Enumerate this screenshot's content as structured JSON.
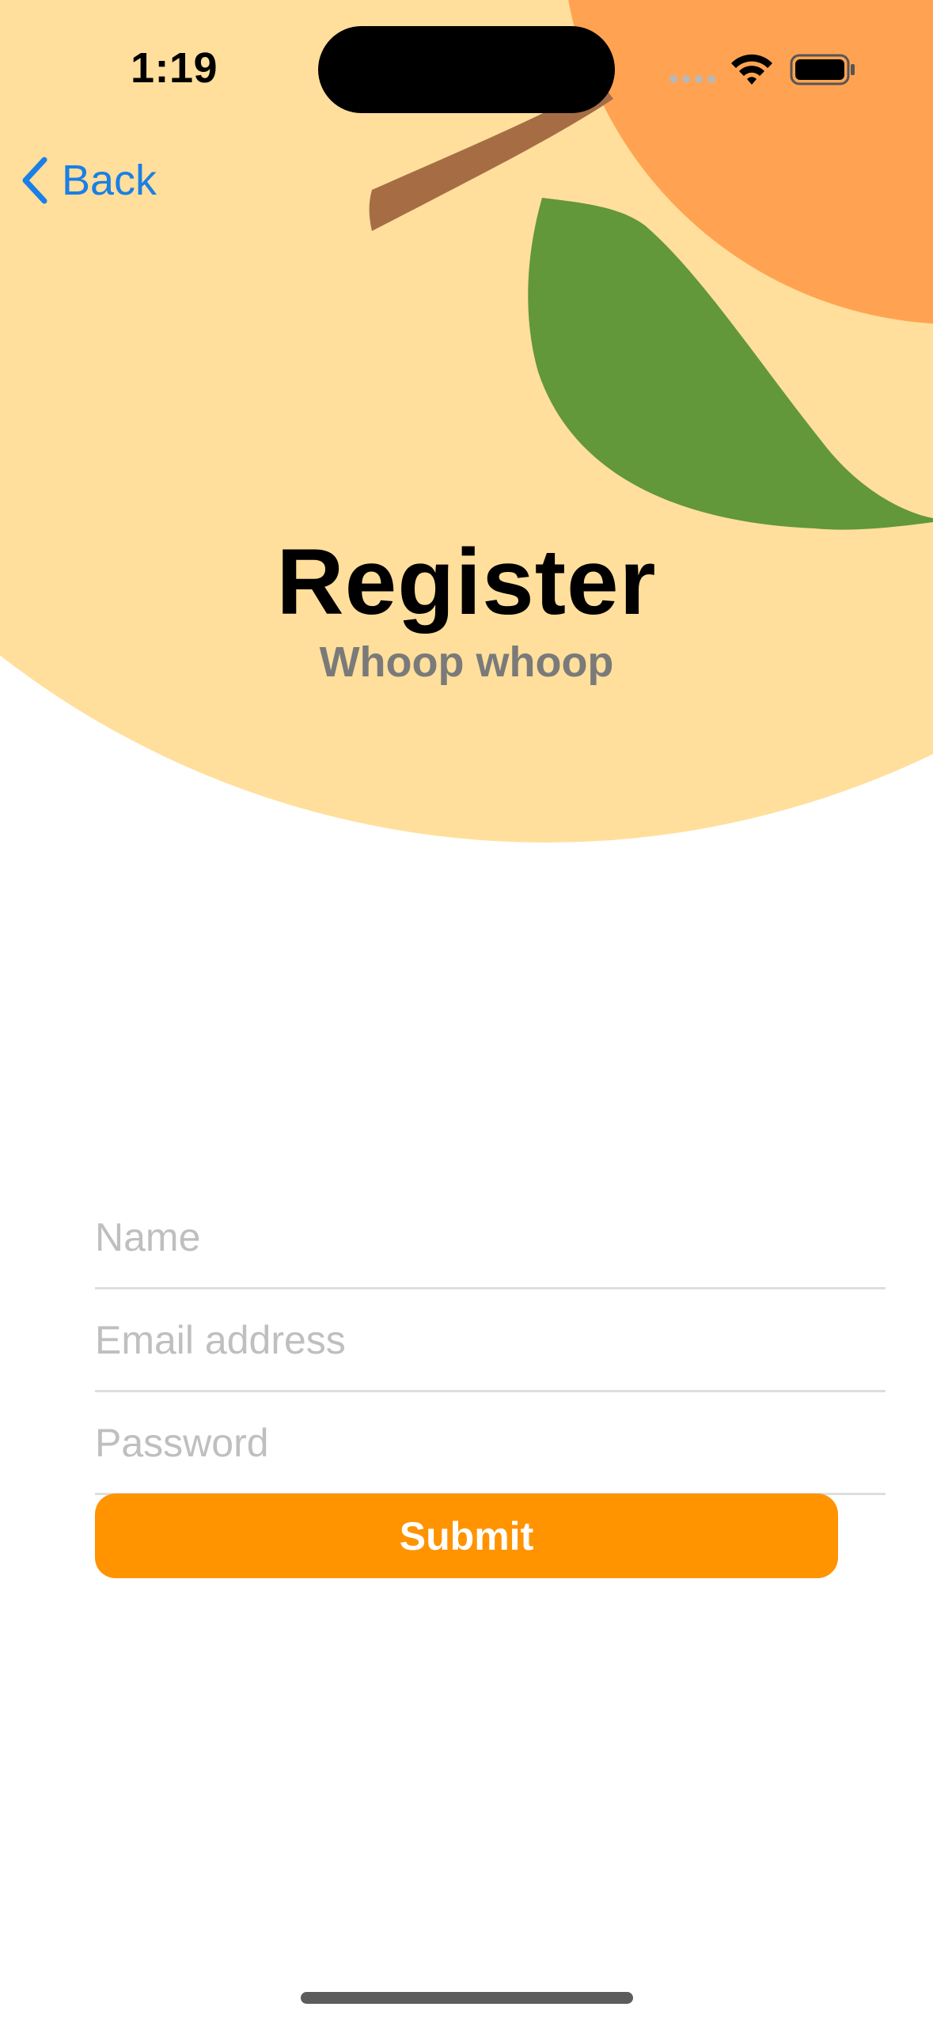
{
  "status_bar": {
    "time": "1:19"
  },
  "navigation": {
    "back_label": "Back"
  },
  "header": {
    "title": "Register",
    "subtitle": "Whoop whoop"
  },
  "form": {
    "name_placeholder": "Name",
    "email_placeholder": "Email address",
    "password_placeholder": "Password",
    "submit_label": "Submit"
  },
  "colors": {
    "accent": "#ff9300",
    "link": "#1a7fe6",
    "hero_background": "#ffdf9b",
    "orange_fruit": "#ffa352",
    "leaf": "#62973a",
    "stem": "#a66d45"
  },
  "icons": [
    "chevron-left-icon",
    "signal-icon",
    "wifi-icon",
    "battery-icon"
  ]
}
